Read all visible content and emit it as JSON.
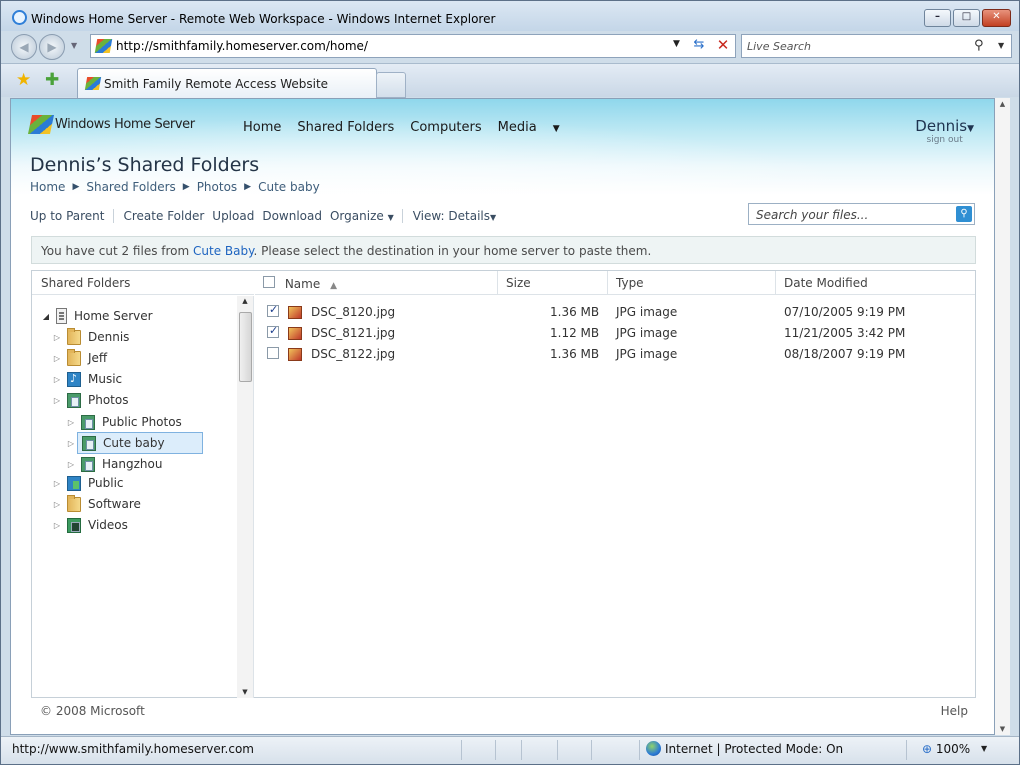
{
  "browser": {
    "title": "Windows Home Server - Remote Web Workspace - Windows Internet Explorer",
    "url": "http://smithfamily.homeserver.com/home/",
    "search_placeholder": "Live Search",
    "tab_label": "Smith Family Remote Access Website",
    "status_url": "http://www.smithfamily.homeserver.com",
    "zone": "Internet | Protected Mode: On",
    "zoom": "100%"
  },
  "site": {
    "logo_text": "Windows Home Server",
    "nav": [
      "Home",
      "Shared Folders",
      "Computers",
      "Media"
    ],
    "user": "Dennis",
    "sign_out": "sign out",
    "page_title": "Dennis’s Shared Folders",
    "breadcrumb": [
      "Home",
      "Shared Folders",
      "Photos",
      "Cute baby"
    ]
  },
  "toolbar": {
    "up": "Up to Parent",
    "create": "Create Folder",
    "upload": "Upload",
    "download": "Download",
    "organize": "Organize",
    "view": "View: Details",
    "search_placeholder": "Search your files..."
  },
  "notice": {
    "before": "You have cut 2 files from ",
    "link": "Cute Baby",
    "after": ". Please select the destination in your home server to paste them."
  },
  "tree": {
    "header": "Shared Folders",
    "items": [
      {
        "label": "Home Server",
        "icon": "server",
        "level": 0
      },
      {
        "label": "Dennis",
        "icon": "folder",
        "level": 1
      },
      {
        "label": "Jeff",
        "icon": "folder",
        "level": 1
      },
      {
        "label": "Music",
        "icon": "music",
        "level": 1
      },
      {
        "label": "Photos",
        "icon": "photo",
        "level": 1
      },
      {
        "label": "Public Photos",
        "icon": "photo",
        "level": 2
      },
      {
        "label": "Cute baby",
        "icon": "photo",
        "level": 2,
        "selected": true
      },
      {
        "label": "Hangzhou",
        "icon": "photo",
        "level": 2
      },
      {
        "label": "Public",
        "icon": "pub",
        "level": 1
      },
      {
        "label": "Software",
        "icon": "folder",
        "level": 1
      },
      {
        "label": "Videos",
        "icon": "video",
        "level": 1
      }
    ]
  },
  "files": {
    "columns": [
      "Name",
      "Size",
      "Type",
      "Date Modified"
    ],
    "rows": [
      {
        "checked": true,
        "name": "DSC_8120.jpg",
        "size": "1.36 MB",
        "type": "JPG image",
        "date": "07/10/2005 9:19 PM"
      },
      {
        "checked": true,
        "name": "DSC_8121.jpg",
        "size": "1.12 MB",
        "type": "JPG image",
        "date": "11/21/2005 3:42 PM"
      },
      {
        "checked": false,
        "name": "DSC_8122.jpg",
        "size": "1.36 MB",
        "type": "JPG image",
        "date": "08/18/2007 9:19 PM"
      }
    ]
  },
  "footer": {
    "copyright": "© 2008 Microsoft",
    "help": "Help"
  }
}
